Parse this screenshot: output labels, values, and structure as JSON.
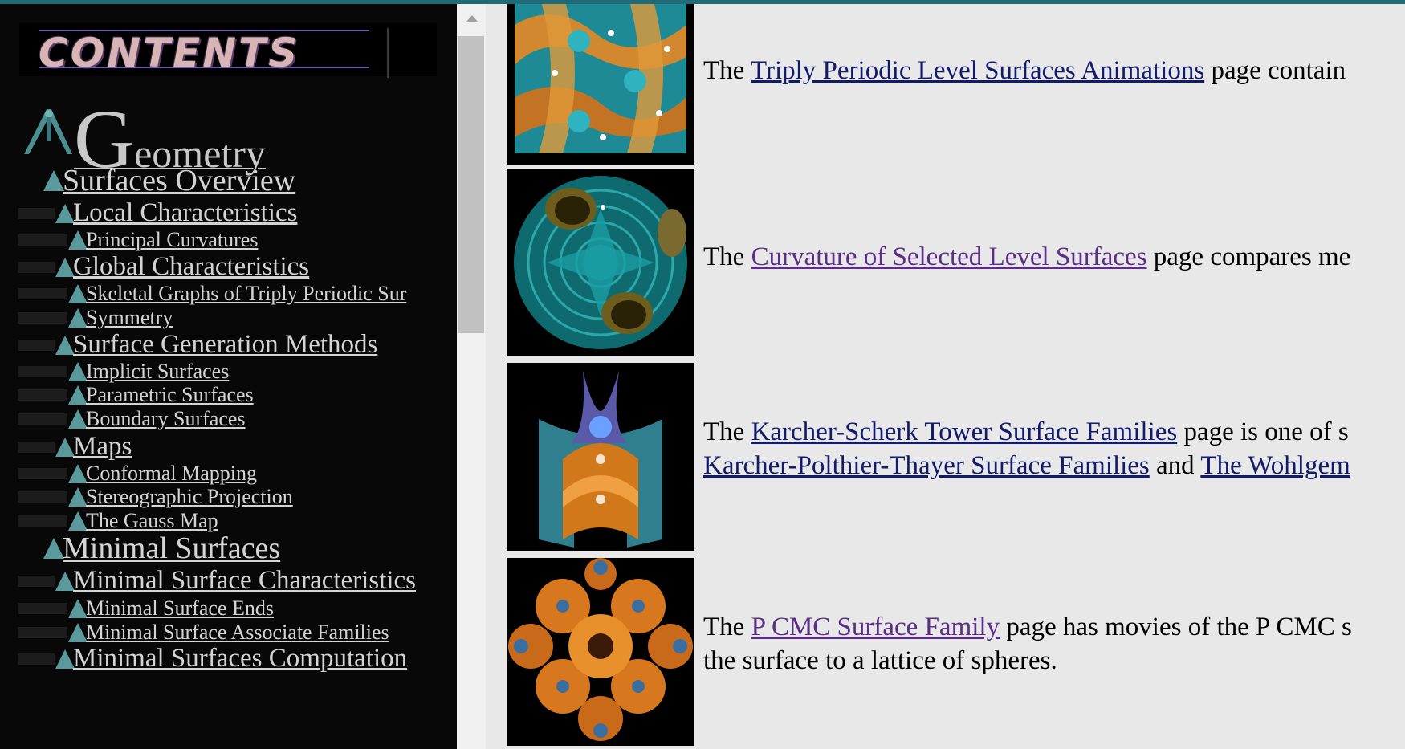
{
  "nav": {
    "banner": "CONTENTS",
    "geometry": {
      "first": "G",
      "rest": "eometry"
    },
    "items": [
      {
        "label": "Surfaces Overview",
        "level": 1
      },
      {
        "label": "Local Characteristics",
        "level": 2
      },
      {
        "label": "Principal Curvatures",
        "level": 3
      },
      {
        "label": "Global Characteristics",
        "level": 2
      },
      {
        "label": "Skeletal Graphs of Triply Periodic Sur",
        "level": 3
      },
      {
        "label": "Symmetry",
        "level": 3
      },
      {
        "label": "Surface Generation Methods",
        "level": 2
      },
      {
        "label": "Implicit Surfaces",
        "level": 3
      },
      {
        "label": "Parametric Surfaces",
        "level": 3
      },
      {
        "label": "Boundary Surfaces",
        "level": 3
      },
      {
        "label": "Maps",
        "level": 2
      },
      {
        "label": "Conformal Mapping",
        "level": 3
      },
      {
        "label": "Stereographic Projection",
        "level": 3
      },
      {
        "label": "The Gauss Map",
        "level": 3
      },
      {
        "label": "Minimal Surfaces",
        "level": 1
      },
      {
        "label": "Minimal Surface Characteristics",
        "level": 2
      },
      {
        "label": "Minimal Surface Ends",
        "level": 3
      },
      {
        "label": "Minimal Surface Associate Families",
        "level": 3
      },
      {
        "label": "Minimal Surfaces Computation",
        "level": 2
      }
    ]
  },
  "main": {
    "rows": [
      {
        "pre": "The ",
        "link": "Triply Periodic Level Surfaces Animations",
        "post": " page contain",
        "line2": null
      },
      {
        "pre": "The ",
        "link": "Curvature of Selected Level Surfaces",
        "post": " page compares me",
        "line2": null
      },
      {
        "pre": "The ",
        "link": "Karcher-Scherk Tower Surface Families",
        "post": " page is one of s",
        "line2": {
          "link1": "Karcher-Polthier-Thayer Surface Families",
          "mid": " and ",
          "link2": "The Wohlgem"
        }
      },
      {
        "pre": "The ",
        "link": "P CMC Surface Family",
        "post": " page has movies of the P CMC s",
        "line2": {
          "text": "the surface to a lattice of spheres."
        }
      }
    ]
  },
  "colors": {
    "accent_bar": "#206a78",
    "nav_bg": "#080808",
    "nav_link": "#d4d4d4",
    "triangle": "#5a9a9c",
    "link": "#121a6c",
    "visited": "#5b2d86",
    "content_bg": "#e8e8e8"
  }
}
